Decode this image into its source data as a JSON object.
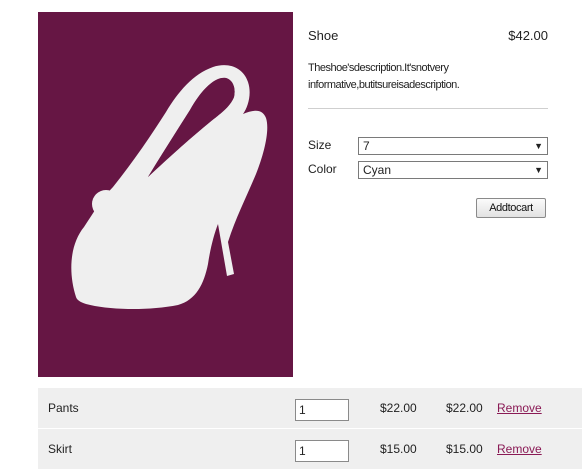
{
  "product": {
    "name": "Shoe",
    "price": "$42.00",
    "description": "Theshoe'sdescription.It'snotvery informative,butitsureisadescription.",
    "image_bg": "#661644",
    "image_icon": "high-heel-shoe-icon"
  },
  "options": {
    "size_label": "Size",
    "size_value": "7",
    "color_label": "Color",
    "color_value": "Cyan"
  },
  "actions": {
    "add_to_cart_label": "Addtocart"
  },
  "cart": {
    "items": [
      {
        "name": "Pants",
        "qty": "1",
        "unit_price": "$22.00",
        "total": "$22.00",
        "remove_label": "Remove"
      },
      {
        "name": "Skirt",
        "qty": "1",
        "unit_price": "$15.00",
        "total": "$15.00",
        "remove_label": "Remove"
      }
    ]
  },
  "colors": {
    "remove_link": "#8a1a55",
    "row_bg": "#efefef"
  }
}
